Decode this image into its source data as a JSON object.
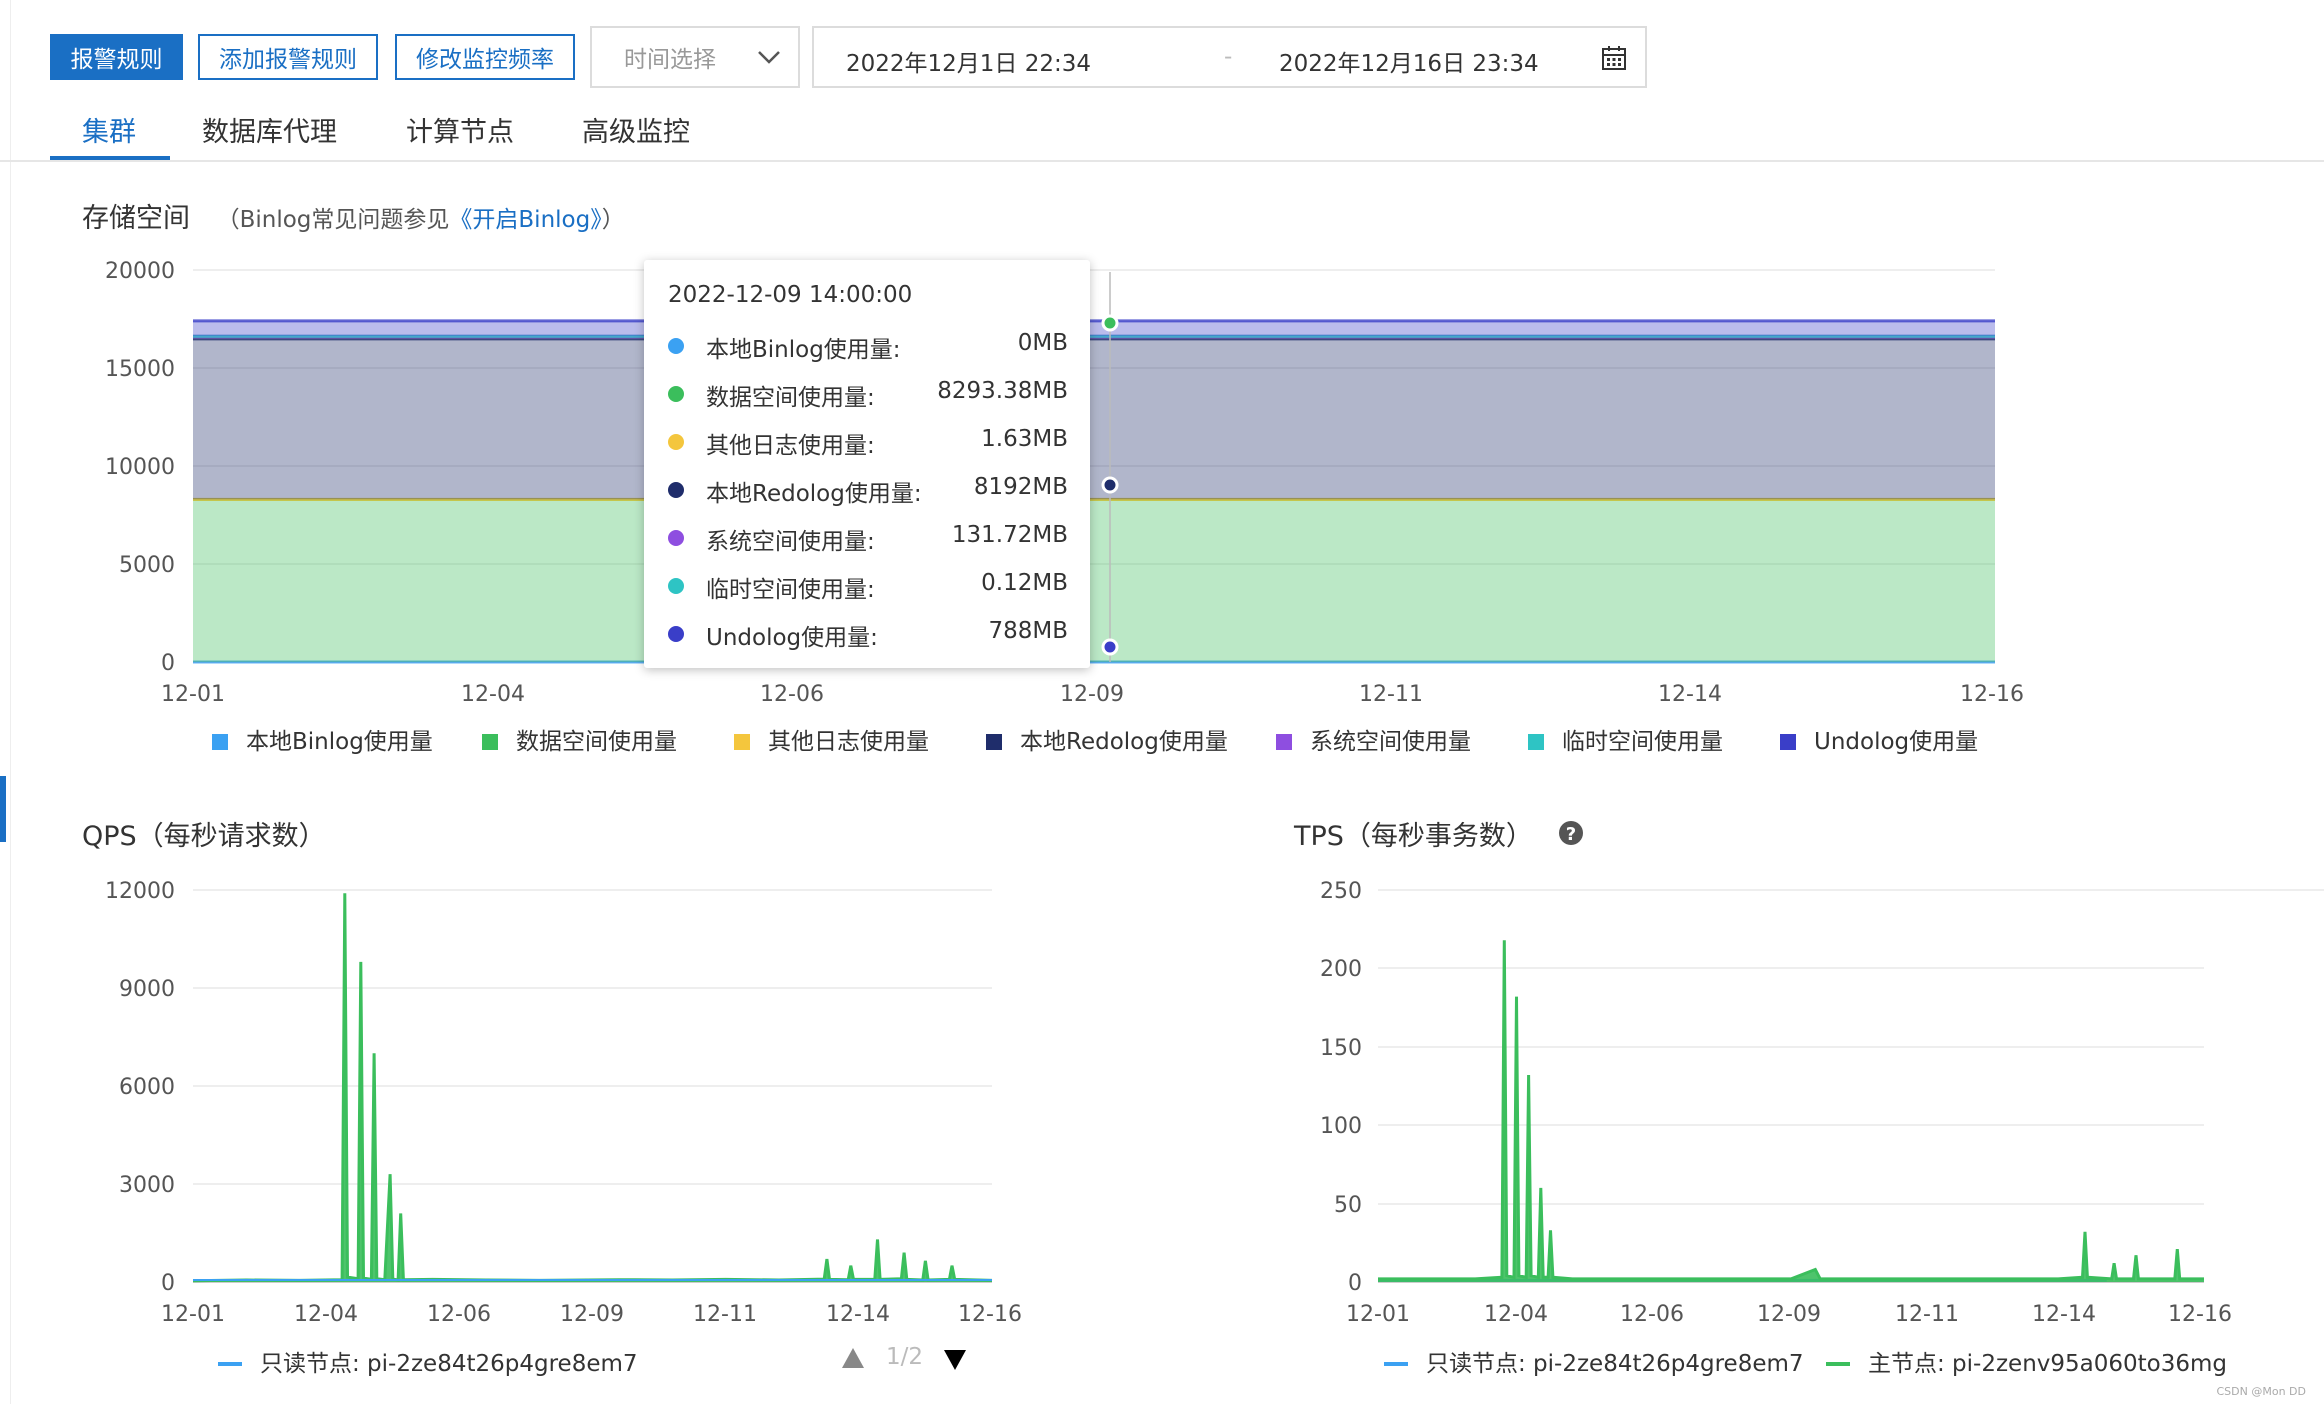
{
  "toolbar": {
    "alarm_rules": "报警规则",
    "add_alarm_rule": "添加报警规则",
    "modify_frequency": "修改监控频率",
    "time_select_placeholder": "时间选择",
    "start_time": "2022年12月1日 22:34",
    "range_separator": "-",
    "end_time": "2022年12月16日 23:34"
  },
  "tabs": [
    {
      "label": "集群",
      "active": true
    },
    {
      "label": "数据库代理",
      "active": false
    },
    {
      "label": "计算节点",
      "active": false
    },
    {
      "label": "高级监控",
      "active": false
    }
  ],
  "storage": {
    "title": "存储空间",
    "note_prefix": "（Binlog常见问题参见",
    "note_link": "《开启Binlog》",
    "note_suffix": "）",
    "tooltip": {
      "time": "2022-12-09 14:00:00",
      "rows": [
        {
          "label": "本地Binlog使用量:",
          "value": "0MB",
          "color": "#3ba1f2"
        },
        {
          "label": "数据空间使用量:",
          "value": "8293.38MB",
          "color": "#3bbe5c"
        },
        {
          "label": "其他日志使用量:",
          "value": "1.63MB",
          "color": "#f4c63d"
        },
        {
          "label": "本地Redolog使用量:",
          "value": "8192MB",
          "color": "#1f2d6b"
        },
        {
          "label": "系统空间使用量:",
          "value": "131.72MB",
          "color": "#8e4ee0"
        },
        {
          "label": "临时空间使用量:",
          "value": "0.12MB",
          "color": "#2ec4c4"
        },
        {
          "label": "Undolog使用量:",
          "value": "788MB",
          "color": "#3a3ec8"
        }
      ]
    }
  },
  "qps": {
    "title": "QPS（每秒请求数）",
    "pager": "1/2"
  },
  "tps": {
    "title": "TPS（每秒事务数）"
  },
  "watermark": "CSDN @Mon DD",
  "chart_data": [
    {
      "type": "area",
      "title": "存储空间",
      "x": [
        "12-01",
        "12-04",
        "12-06",
        "12-09",
        "12-11",
        "12-14",
        "12-16"
      ],
      "ylim": [
        0,
        20000
      ],
      "yticks": [
        "20000",
        "15000",
        "10000",
        "5000",
        "0"
      ],
      "stacked": true,
      "legend_position": "bottom",
      "series": [
        {
          "name": "本地Binlog使用量",
          "color": "#3ba1f2",
          "values": [
            0,
            0,
            0,
            0,
            0,
            0,
            0
          ]
        },
        {
          "name": "数据空间使用量",
          "color": "#3bbe5c",
          "values": [
            8293,
            8293,
            8293,
            8293,
            8293,
            8293,
            8293
          ]
        },
        {
          "name": "其他日志使用量",
          "color": "#f4c63d",
          "values": [
            2,
            2,
            2,
            2,
            2,
            2,
            2
          ]
        },
        {
          "name": "本地Redolog使用量",
          "color": "#1f2d6b",
          "values": [
            8192,
            8192,
            8192,
            8192,
            8192,
            8192,
            8192
          ]
        },
        {
          "name": "系统空间使用量",
          "color": "#8e4ee0",
          "values": [
            132,
            132,
            132,
            132,
            132,
            132,
            132
          ]
        },
        {
          "name": "临时空间使用量",
          "color": "#2ec4c4",
          "values": [
            0,
            0,
            0,
            0,
            0,
            0,
            0
          ]
        },
        {
          "name": "Undolog使用量",
          "color": "#3a3ec8",
          "values": [
            788,
            788,
            788,
            788,
            788,
            788,
            788
          ]
        }
      ]
    },
    {
      "type": "line",
      "title": "QPS（每秒请求数）",
      "xticks": [
        "12-01",
        "12-04",
        "12-06",
        "12-09",
        "12-11",
        "12-14",
        "12-16"
      ],
      "ylim": [
        0,
        12000
      ],
      "yticks": [
        "12000",
        "9000",
        "6000",
        "3000",
        "0"
      ],
      "legend_position": "bottom",
      "series": [
        {
          "name": "只读节点: pi-2ze84t26p4gre8em7",
          "color": "#3ba1f2",
          "points": [
            [
              0,
              40
            ],
            [
              1,
              60
            ],
            [
              2,
              50
            ],
            [
              2.8,
              70
            ],
            [
              2.85,
              11900
            ],
            [
              2.9,
              150
            ],
            [
              3.1,
              100
            ],
            [
              3.15,
              9800
            ],
            [
              3.2,
              120
            ],
            [
              3.35,
              80
            ],
            [
              3.4,
              7000
            ],
            [
              3.45,
              100
            ],
            [
              3.6,
              70
            ],
            [
              3.7,
              3300
            ],
            [
              3.75,
              90
            ],
            [
              3.85,
              60
            ],
            [
              3.9,
              2100
            ],
            [
              3.95,
              70
            ],
            [
              4.5,
              80
            ],
            [
              5.5,
              60
            ],
            [
              6.5,
              50
            ],
            [
              8,
              70
            ],
            [
              9,
              60
            ],
            [
              10,
              80
            ],
            [
              11,
              60
            ],
            [
              11.85,
              90
            ],
            [
              11.9,
              700
            ],
            [
              11.95,
              80
            ],
            [
              12.3,
              70
            ],
            [
              12.35,
              500
            ],
            [
              12.4,
              80
            ],
            [
              12.8,
              80
            ],
            [
              12.85,
              1300
            ],
            [
              12.9,
              80
            ],
            [
              13.3,
              100
            ],
            [
              13.35,
              900
            ],
            [
              13.4,
              80
            ],
            [
              13.7,
              60
            ],
            [
              13.75,
              650
            ],
            [
              13.8,
              60
            ],
            [
              14.2,
              80
            ],
            [
              14.25,
              500
            ],
            [
              14.3,
              80
            ],
            [
              15,
              50
            ]
          ]
        }
      ]
    },
    {
      "type": "line",
      "title": "TPS（每秒事务数）",
      "xticks": [
        "12-01",
        "12-04",
        "12-06",
        "12-09",
        "12-11",
        "12-14",
        "12-16"
      ],
      "ylim": [
        0,
        250
      ],
      "yticks": [
        "250",
        "200",
        "150",
        "100",
        "50",
        "0"
      ],
      "legend_position": "bottom",
      "series": [
        {
          "name": "只读节点: pi-2ze84t26p4gre8em7",
          "color": "#3ba1f2",
          "points": [
            [
              0,
              1
            ],
            [
              15,
              1
            ]
          ]
        },
        {
          "name": "主节点: pi-2zenv95a060to36mg",
          "color": "#3bbe5c",
          "points": [
            [
              0,
              2
            ],
            [
              2,
              2
            ],
            [
              2.55,
              3
            ],
            [
              2.6,
              218
            ],
            [
              2.65,
              4
            ],
            [
              2.8,
              3
            ],
            [
              2.85,
              182
            ],
            [
              2.9,
              4
            ],
            [
              3.05,
              3
            ],
            [
              3.1,
              132
            ],
            [
              3.15,
              4
            ],
            [
              3.3,
              3
            ],
            [
              3.35,
              60
            ],
            [
              3.4,
              3
            ],
            [
              3.5,
              3
            ],
            [
              3.55,
              33
            ],
            [
              3.6,
              3
            ],
            [
              4,
              2
            ],
            [
              8.5,
              2
            ],
            [
              9,
              8
            ],
            [
              9.1,
              2
            ],
            [
              14,
              2
            ],
            [
              14.5,
              3
            ],
            [
              14.55,
              32
            ],
            [
              14.6,
              3
            ],
            [
              15.1,
              2
            ],
            [
              15.15,
              12
            ],
            [
              15.2,
              2
            ],
            [
              15.55,
              2
            ],
            [
              15.6,
              17
            ],
            [
              15.65,
              2
            ],
            [
              16.4,
              2
            ],
            [
              16.45,
              21
            ],
            [
              16.5,
              2
            ],
            [
              17,
              2
            ]
          ]
        }
      ]
    }
  ]
}
